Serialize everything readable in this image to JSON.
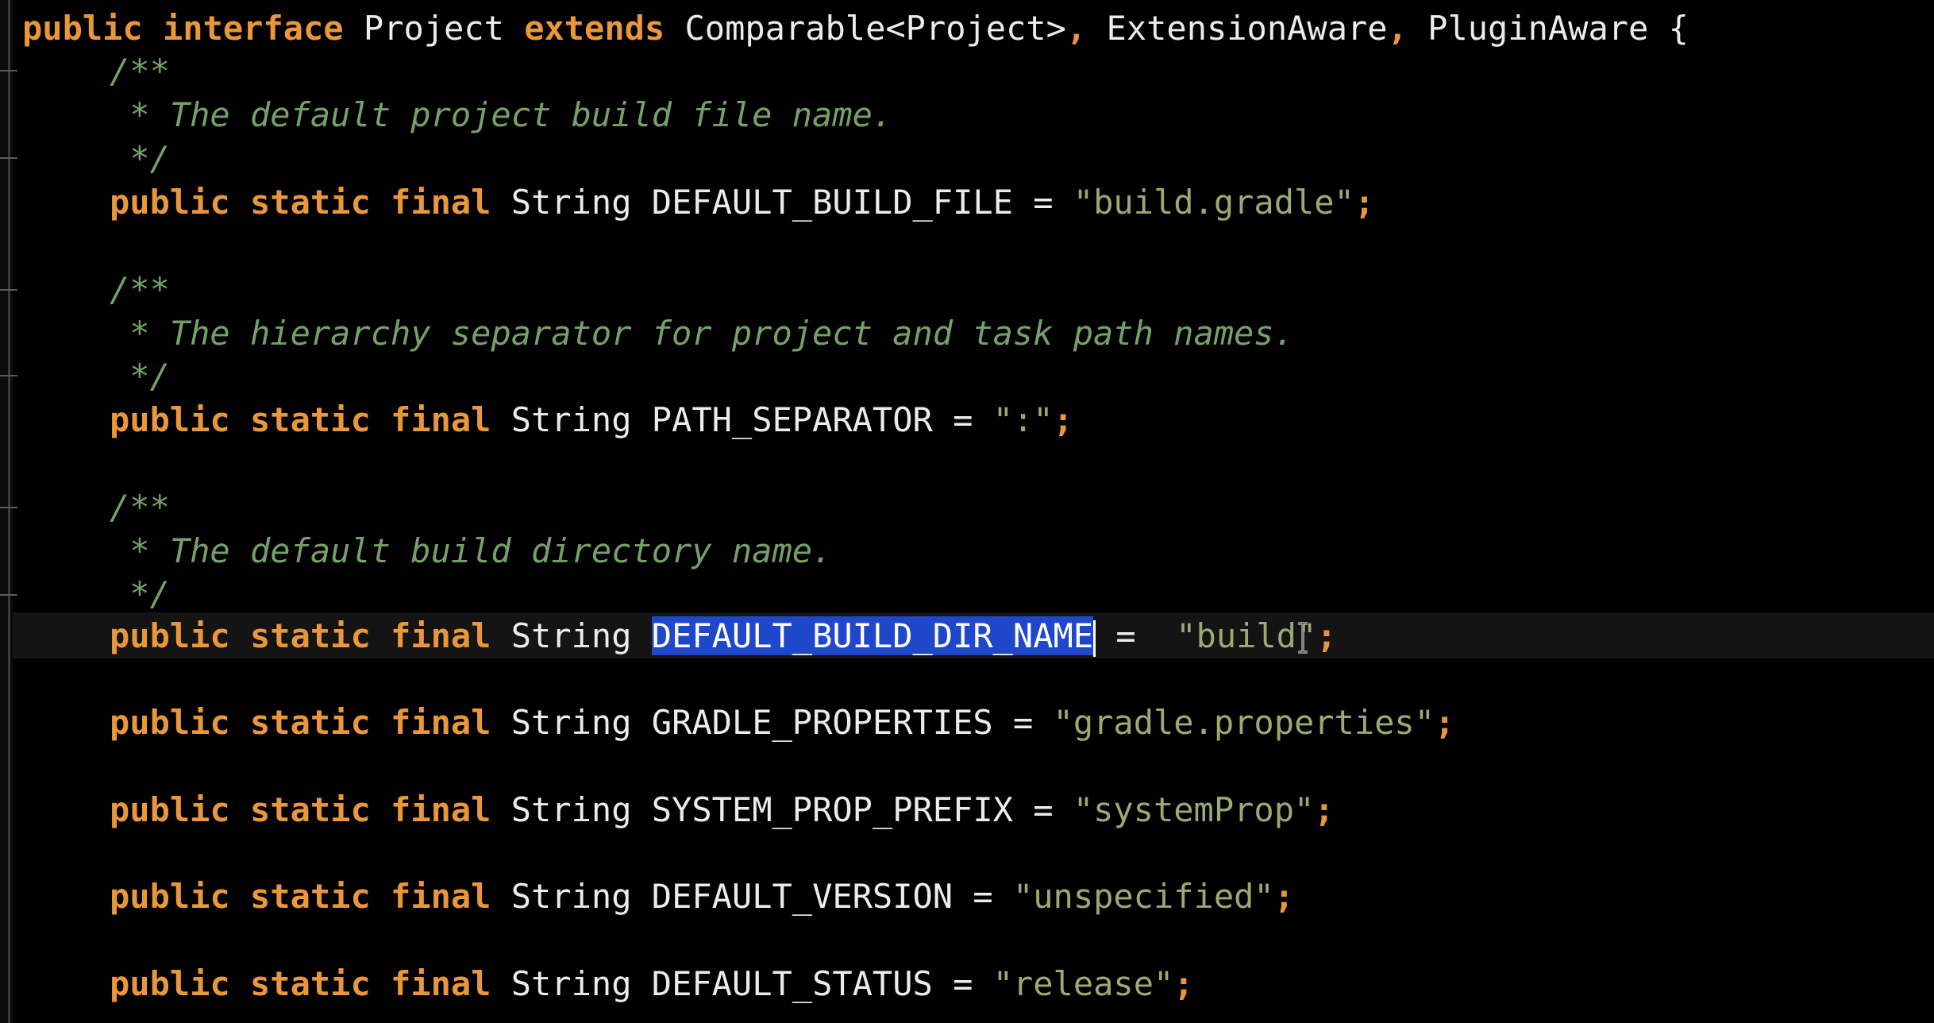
{
  "header_line": {
    "kw_public": "public",
    "kw_interface": "interface",
    "name": "Project",
    "kw_extends": "extends",
    "t1": "Comparable<Project>",
    "t2": "ExtensionAware",
    "t3": "PluginAware",
    "brace": "{",
    "comma": ","
  },
  "comments": [
    {
      "open": "/**",
      "body": " * The default project build file name.",
      "close": " */"
    },
    {
      "open": "/**",
      "body": " * The hierarchy separator for project and task path names.",
      "close": " */"
    },
    {
      "open": "/**",
      "body": " * The default build directory name.",
      "close": " */"
    }
  ],
  "decl_keywords": {
    "public": "public",
    "static": "static",
    "final": "final",
    "type": "String",
    "eq": "=",
    "semi": ";"
  },
  "constants": [
    {
      "name": "DEFAULT_BUILD_FILE",
      "value": "\"build.gradle\""
    },
    {
      "name": "PATH_SEPARATOR",
      "value": "\":\""
    },
    {
      "name": "DEFAULT_BUILD_DIR_NAME",
      "value": "\"build\"",
      "selected": true
    },
    {
      "name": "GRADLE_PROPERTIES",
      "value": "\"gradle.properties\""
    },
    {
      "name": "SYSTEM_PROP_PREFIX",
      "value": "\"systemProp\""
    },
    {
      "name": "DEFAULT_VERSION",
      "value": "\"unspecified\""
    },
    {
      "name": "DEFAULT_STATUS",
      "value": "\"release\""
    }
  ],
  "colors": {
    "background": "#000000",
    "keyword": "#e9973a",
    "comment": "#76a06a",
    "string": "#9aaa72",
    "identifier": "#ececec",
    "selection": "#1e47c9"
  },
  "icons": {
    "cursor": "text-cursor-icon"
  }
}
